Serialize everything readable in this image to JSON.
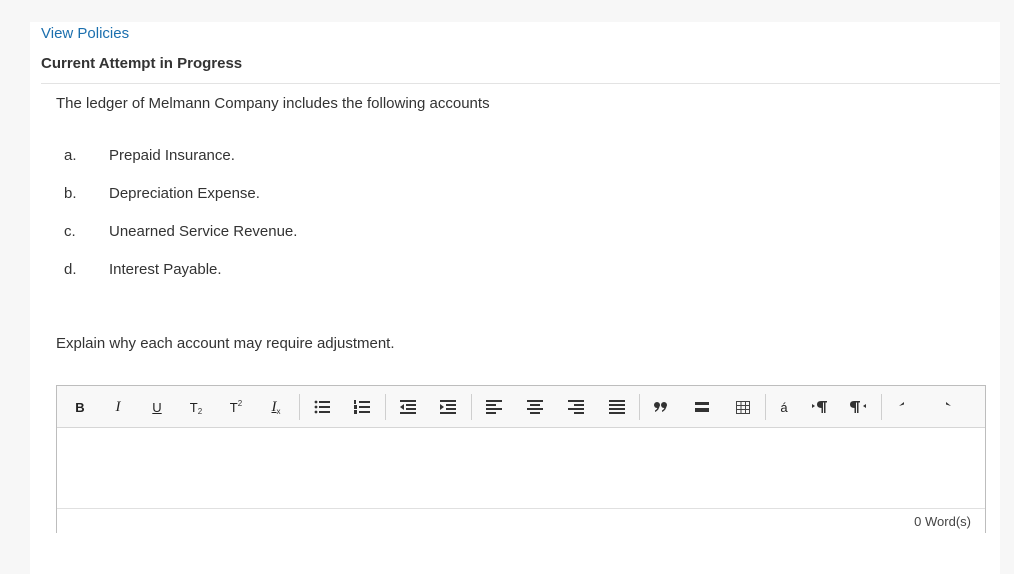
{
  "header": {
    "policies_link": "View Policies",
    "attempt_title": "Current Attempt in Progress"
  },
  "question": {
    "intro": "The ledger of Melmann Company includes the following accounts",
    "items": [
      {
        "letter": "a.",
        "text": "Prepaid Insurance."
      },
      {
        "letter": "b.",
        "text": "Depreciation Expense."
      },
      {
        "letter": "c.",
        "text": "Unearned Service Revenue."
      },
      {
        "letter": "d.",
        "text": "Interest Payable."
      }
    ],
    "prompt": "Explain why each account may require adjustment."
  },
  "editor": {
    "toolbar": {
      "bold": "B",
      "italic": "I",
      "underline": "U",
      "subscript": "T",
      "superscript": "T",
      "clear_format": "I",
      "special_char": "á"
    },
    "value": "",
    "word_count": "0 Word(s)"
  },
  "colors": {
    "link": "#1b6fae",
    "text": "#333333",
    "page_bg": "#f7f7f7",
    "toolbar_bg": "#f8f8f8"
  }
}
